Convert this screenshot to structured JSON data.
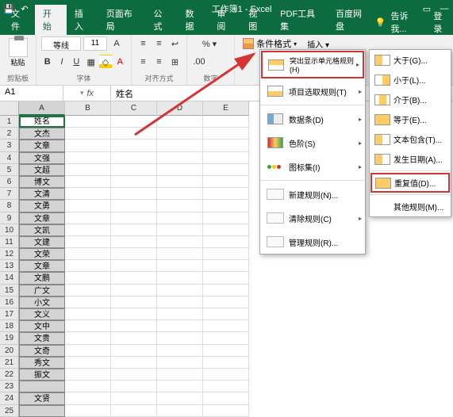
{
  "titlebar": {
    "title": "工作簿1 - Excel"
  },
  "tabs": {
    "file": "文件",
    "home": "开始",
    "insert": "插入",
    "layout": "页面布局",
    "formulas": "公式",
    "data": "数据",
    "review": "审阅",
    "view": "视图",
    "pdf": "PDF工具集",
    "baidu": "百度网盘",
    "tell_me": "告诉我...",
    "login": "登录"
  },
  "ribbon": {
    "paste": "粘贴",
    "clipboard": "剪贴板",
    "font": "字体",
    "align": "对齐方式",
    "number": "数字",
    "font_name": "等线",
    "font_size": "11",
    "bold": "B",
    "italic": "I",
    "underline": "U",
    "cond_format": "条件格式",
    "insert_btn": "插入"
  },
  "menu": {
    "highlight_rules": "突出显示单元格规则(H)",
    "top_bottom": "项目选取规则(T)",
    "data_bars": "数据条(D)",
    "color_scales": "色阶(S)",
    "icon_sets": "图标集(I)",
    "new_rule": "新建规则(N)...",
    "clear_rules": "清除规则(C)",
    "manage_rules": "管理规则(R)..."
  },
  "submenu": {
    "greater": "大于(G)...",
    "less": "小于(L)...",
    "between": "介于(B)...",
    "equal": "等于(E)...",
    "text_contains": "文本包含(T)...",
    "date_occurring": "发生日期(A)...",
    "duplicate": "重复值(D)...",
    "more_rules": "其他规则(M)..."
  },
  "formula_bar": {
    "name_box": "A1",
    "fx": "fx",
    "value": "姓名"
  },
  "columns": [
    "A",
    "B",
    "C",
    "D",
    "E"
  ],
  "rows": [
    "姓名",
    "文杰",
    "文章",
    "文强",
    "文超",
    "博文",
    "文清",
    "文勇",
    "文章",
    "文凯",
    "文建",
    "文荣",
    "文章",
    "文鹏",
    "广文",
    "小文",
    "文义",
    "文中",
    "文贵",
    "文奇",
    "秀文",
    "振文",
    "",
    "文贤",
    ""
  ]
}
